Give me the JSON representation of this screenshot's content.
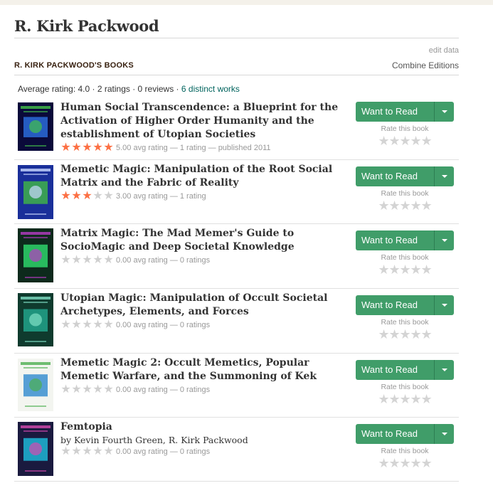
{
  "author": {
    "name": "R. Kirk Packwood"
  },
  "edit_data": "edit data",
  "section": {
    "title": "R. KIRK PACKWOOD'S BOOKS",
    "combine": "Combine Editions"
  },
  "summary": {
    "prefix": "Average rating: 4.0 · 2 ratings · 0 reviews · ",
    "link": "6 distinct works"
  },
  "labels": {
    "want_to_read": "Want to Read",
    "rate_this_book": "Rate this book"
  },
  "colors": {
    "star_on": "#fc7044",
    "star_off": "#d0d0d0",
    "button": "#409d69",
    "link": "#00635d"
  },
  "books": [
    {
      "title": "Human Social Transcendence: a Blueprint for the Activation of Higher Order Humanity and the establishment of Utopian Societies",
      "byline": "",
      "stars": 5,
      "meta": "5.00 avg rating — 1 rating — published 2011"
    },
    {
      "title": "Memetic Magic: Manipulation of the Root Social Matrix and the Fabric of Reality",
      "byline": "",
      "stars": 3,
      "meta": "3.00 avg rating — 1 rating"
    },
    {
      "title": "Matrix Magic: The Mad Memer's Guide to SocioMagic and Deep Societal Knowledge",
      "byline": "",
      "stars": 0,
      "meta": "0.00 avg rating — 0 ratings"
    },
    {
      "title": "Utopian Magic: Manipulation of Occult Societal Archetypes, Elements, and Forces",
      "byline": "",
      "stars": 0,
      "meta": "0.00 avg rating — 0 ratings"
    },
    {
      "title": "Memetic Magic 2: Occult Memetics, Popular Memetic Warfare, and the Summoning of Kek",
      "byline": "",
      "stars": 0,
      "meta": "0.00 avg rating — 0 ratings"
    },
    {
      "title": "Femtopia",
      "byline": "by Kevin Fourth Green, R. Kirk Packwood",
      "stars": 0,
      "meta": "0.00 avg rating — 0 ratings"
    }
  ]
}
